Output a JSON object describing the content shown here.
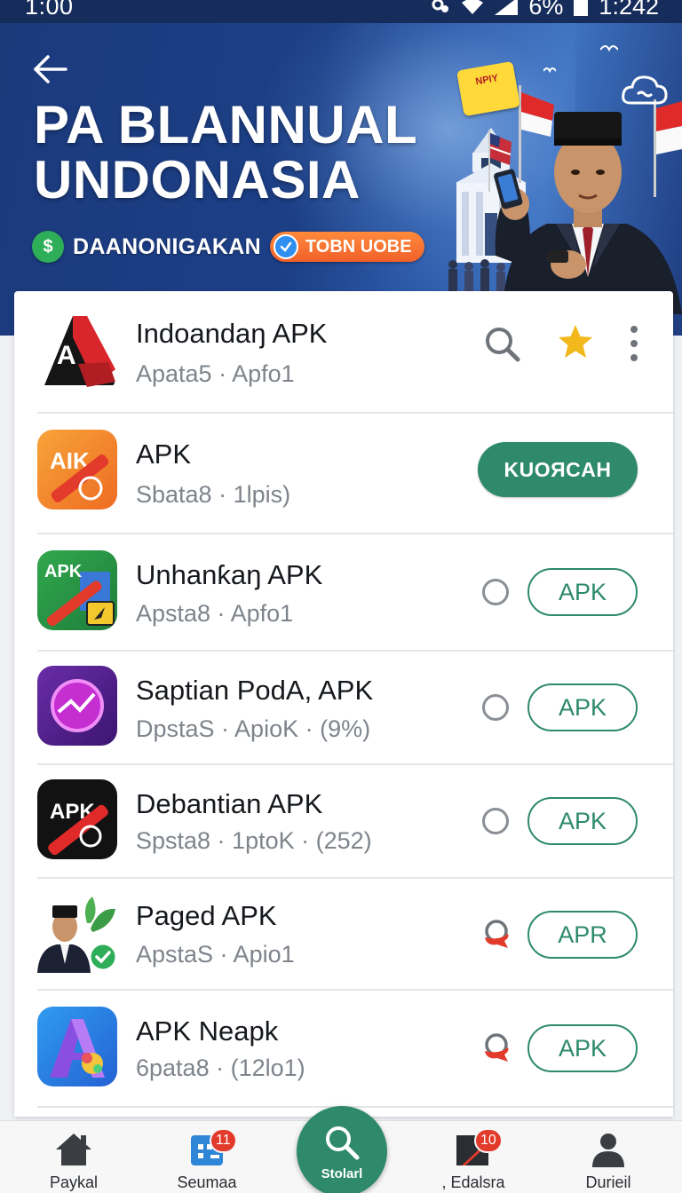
{
  "status_bar": {
    "time": "1:00",
    "battery_text": "6%",
    "clock_right": "1:242"
  },
  "hero": {
    "title_line1": "PA BLANNUAL",
    "title_line2": "UNDONASIA",
    "subtitle": "DAANONIGAKAN",
    "pill_label": "TOBN UOBE",
    "dollar_symbol": "$",
    "sticker_text": "NPIY",
    "colors": {
      "background": "#1c3f86",
      "pill": "#f0602a",
      "accent_green": "#2fae5a"
    }
  },
  "apps": [
    {
      "name": "Indoandaŋ APK",
      "meta": "Apata5 · Apfo1",
      "icon": "red-black-a-app-icon",
      "actions": [
        "search",
        "star",
        "more"
      ]
    },
    {
      "name": "APK",
      "meta": "Sbata8 · 1lpis)",
      "icon": "orange-apk-app-icon",
      "button": "KUOЯCAH"
    },
    {
      "name": "Unhanƙaŋ APK",
      "meta": "Apsta8 · Apfo1",
      "icon": "green-apk-app-icon",
      "button": "APK"
    },
    {
      "name": "Saptian PodA, APK",
      "meta": "DpstaS · ApioK  ·  (9%)",
      "icon": "purple-chart-app-icon",
      "button": "APK"
    },
    {
      "name": "Debantian APK",
      "meta": "Spsta8 · 1ptoK  ·  (252)",
      "icon": "black-apk-app-icon",
      "button": "APK"
    },
    {
      "name": "Paged APK",
      "meta": "ApstaS · Apio1",
      "icon": "person-leaf-app-icon",
      "button": "APR"
    },
    {
      "name": "APK Neapk",
      "meta": "6pata8 · (12lo1)",
      "icon": "blue-a-app-icon",
      "button": "APK"
    }
  ],
  "bottom_nav": {
    "items": [
      {
        "label": "Paykal",
        "icon": "home-icon"
      },
      {
        "label": "Seumaa",
        "icon": "grid-icon",
        "badge": "11"
      },
      {
        "label": "Stolarl",
        "icon": "search-icon"
      },
      {
        "label": ", Edalsra",
        "icon": "flag-icon",
        "badge": "10"
      },
      {
        "label": "Durieil",
        "icon": "person-icon"
      }
    ]
  },
  "theme": {
    "primary_green": "#2e8a6a",
    "badge_red": "#e23a2b",
    "star_yellow": "#f2b81c"
  }
}
